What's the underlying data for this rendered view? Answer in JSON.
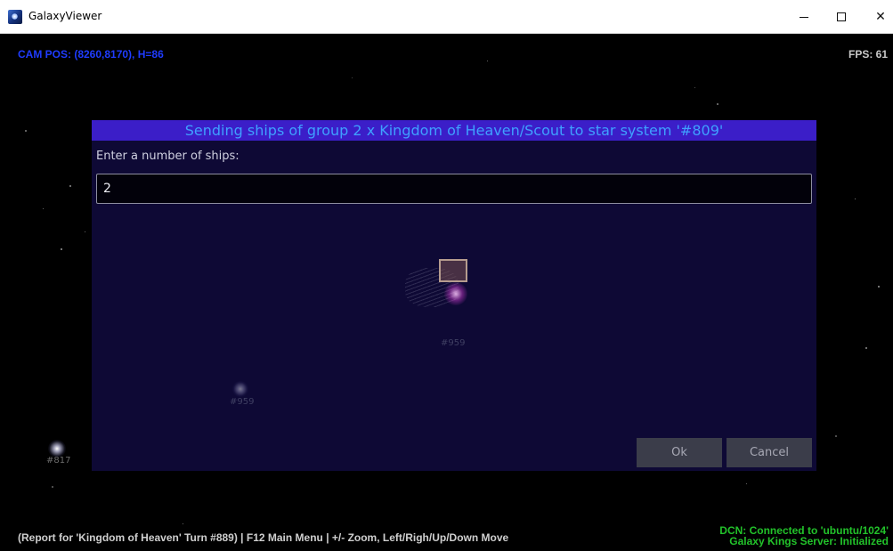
{
  "window": {
    "title": "GalaxyViewer",
    "minimize_glyph": "—",
    "close_glyph": "✕"
  },
  "hud": {
    "cam_pos": "CAM POS: (8260,8170), H=86",
    "fps": "FPS: 61",
    "report": "(Report for 'Kingdom of Heaven' Turn #889) | F12 Main Menu | +/- Zoom, Left/Righ/Up/Down Move",
    "status_line1": "DCN: Connected to 'ubuntu/1024'",
    "status_line2": "Galaxy Kings Server: Initialized"
  },
  "map": {
    "star_label_817": "#817",
    "star_label_959": "#959",
    "star_label_959b": "#959"
  },
  "dialog": {
    "header": "Sending ships of group 2 x Kingdom of Heaven/Scout to star system '#809'",
    "prompt": "Enter a number of ships:",
    "input_value": "2",
    "ok_label": "Ok",
    "cancel_label": "Cancel"
  },
  "colors": {
    "dialog_header_bg": "#3b1ec8",
    "dialog_header_text": "#3fa0ff",
    "cam_text": "#1f3cff",
    "status_text": "#22c22a"
  },
  "icons": {
    "app": "galaxy-app-icon",
    "minimize": "minimize-icon",
    "maximize": "maximize-icon",
    "close": "close-icon"
  }
}
